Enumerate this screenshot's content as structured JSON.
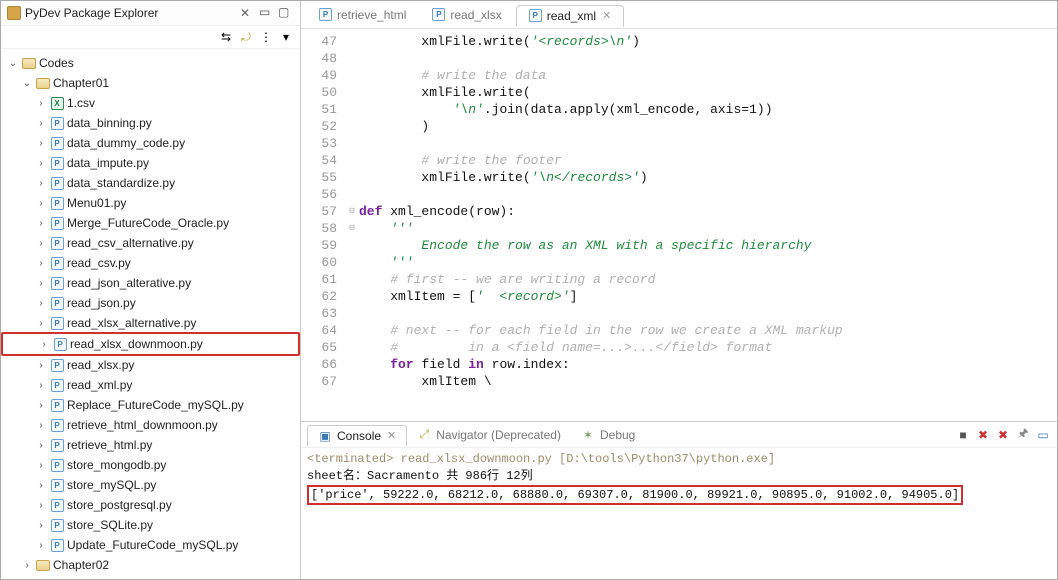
{
  "explorer": {
    "title": "PyDev Package Explorer",
    "root_arrow": "⌄",
    "nodes": {
      "root": "Codes",
      "chapter01": "Chapter01",
      "chapter02": "Chapter02",
      "csv": "1.csv",
      "files": [
        "data_binning.py",
        "data_dummy_code.py",
        "data_impute.py",
        "data_standardize.py",
        "Menu01.py",
        "Merge_FutureCode_Oracle.py",
        "read_csv_alternative.py",
        "read_csv.py",
        "read_json_alterative.py",
        "read_json.py",
        "read_xlsx_alternative.py",
        "read_xlsx_downmoon.py",
        "read_xlsx.py",
        "read_xml.py",
        "Replace_FutureCode_mySQL.py",
        "retrieve_html_downmoon.py",
        "retrieve_html.py",
        "store_mongodb.py",
        "store_mySQL.py",
        "store_postgresql.py",
        "store_SQLite.py",
        "Update_FutureCode_mySQL.py"
      ]
    }
  },
  "editor": {
    "tabs": [
      {
        "label": "retrieve_html",
        "active": false,
        "close": false
      },
      {
        "label": "read_xlsx",
        "active": false,
        "close": false
      },
      {
        "label": "read_xml",
        "active": true,
        "close": true
      }
    ],
    "lines": [
      {
        "n": 47,
        "t": "        xmlFile.write('<records>\\n')",
        "style": "str"
      },
      {
        "n": 48,
        "t": ""
      },
      {
        "n": 49,
        "t": "        # write the data",
        "style": "comment"
      },
      {
        "n": 50,
        "t": "        xmlFile.write("
      },
      {
        "n": 51,
        "t": "            '\\n'.join(data.apply(xml_encode, axis=1))",
        "style": "mix51"
      },
      {
        "n": 52,
        "t": "        )"
      },
      {
        "n": 53,
        "t": ""
      },
      {
        "n": 54,
        "t": "        # write the footer",
        "style": "comment"
      },
      {
        "n": 55,
        "t": "        xmlFile.write('\\n</records>')",
        "style": "str"
      },
      {
        "n": 56,
        "t": ""
      },
      {
        "n": 57,
        "t": "def xml_encode(row):",
        "style": "def",
        "fold": "-"
      },
      {
        "n": 58,
        "t": "    '''",
        "style": "doc",
        "fold": "-"
      },
      {
        "n": 59,
        "t": "        Encode the row as an XML with a specific hierarchy",
        "style": "doc"
      },
      {
        "n": 60,
        "t": "    '''",
        "style": "doc"
      },
      {
        "n": 61,
        "t": "    # first -- we are writing a record",
        "style": "comment"
      },
      {
        "n": 62,
        "t": "    xmlItem = ['  <record>']",
        "style": "str62"
      },
      {
        "n": 63,
        "t": ""
      },
      {
        "n": 64,
        "t": "    # next -- for each field in the row we create a XML markup",
        "style": "comment"
      },
      {
        "n": 65,
        "t": "    #         in a <field name=...>...</field> format",
        "style": "comment"
      },
      {
        "n": 66,
        "t": "    for field in row.index:",
        "style": "for"
      },
      {
        "n": 67,
        "t": "        xmlItem \\"
      }
    ]
  },
  "console": {
    "tabs": [
      {
        "label": "Console",
        "active": true
      },
      {
        "label": "Navigator (Deprecated)",
        "active": false
      },
      {
        "label": "Debug",
        "active": false
      }
    ],
    "term_prefix": "<terminated> ",
    "term_text": "read_xlsx_downmoon.py [D:\\tools\\Python37\\python.exe]",
    "line2": "sheet名：Sacramento 共 986行 12列",
    "line3": "['price', 59222.0, 68212.0, 68880.0, 69307.0, 81900.0, 89921.0, 90895.0, 91002.0, 94905.0]"
  }
}
